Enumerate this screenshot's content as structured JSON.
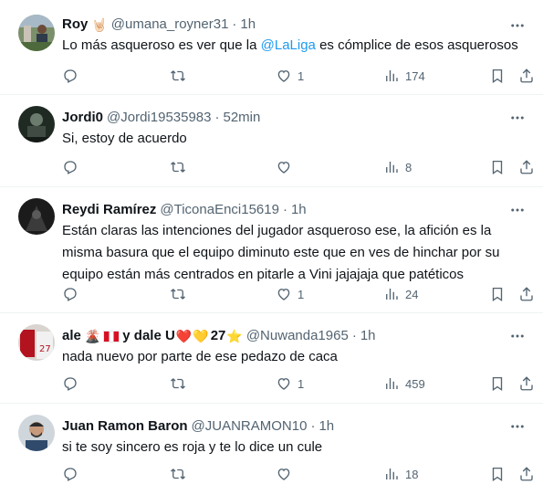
{
  "tweets": [
    {
      "name": "Roy",
      "name_emoji": "🤘🏻",
      "handle": "@umana_royner31",
      "dot": "·",
      "time": "1h",
      "text_before": "Lo más asqueroso es ver que la ",
      "mention": "@LaLiga",
      "text_after": " es cómplice de esos asqueroso​s",
      "likes": "1",
      "views": "174"
    },
    {
      "name": "Jordi0",
      "handle": "@Jordi19535983",
      "dot": "·",
      "time": "52min",
      "text": "Si, estoy de acuerdo",
      "likes": "",
      "views": "8"
    },
    {
      "name": "Reydi Ramírez",
      "handle": "@TiconaEnci15619",
      "dot": "·",
      "time": "1h",
      "text_lines": [
        "Están claras las intenciones del jugador asqueroso ese, la afición es la",
        "misma basura que el equipo diminuto este que en ves de hinchar por su",
        "equipo están más centrados en pitarle a Vini jajajaja que patéticos"
      ],
      "likes": "1",
      "views": "24"
    },
    {
      "name_part1": "ale",
      "emoji1": "🌋",
      "name_part2": "y dale U",
      "emoji_heart1": "❤️",
      "emoji_heart2": "💛",
      "name_part3": "27",
      "emoji_star": "⭐",
      "handle": "@Nuwanda1965",
      "dot": "·",
      "time": "1h",
      "text": "nada nuevo por parte de ese pedazo de caca",
      "likes": "1",
      "views": "459"
    },
    {
      "name": "Juan Ramon Baron",
      "handle": "@JUANRAMON10",
      "dot": "·",
      "time": "1h",
      "text": "si te soy sincero es roja y te lo dice un cule",
      "likes": "",
      "views": "18"
    }
  ],
  "colors": {
    "text": "#0f1419",
    "muted": "#536471",
    "link": "#1d9bf0",
    "divider": "#eff3f4"
  },
  "icons": {
    "reply": "reply-icon",
    "retweet": "retweet-icon",
    "like": "heart-icon",
    "views": "views-icon",
    "bookmark": "bookmark-icon",
    "share": "share-icon",
    "more": "more-icon"
  }
}
